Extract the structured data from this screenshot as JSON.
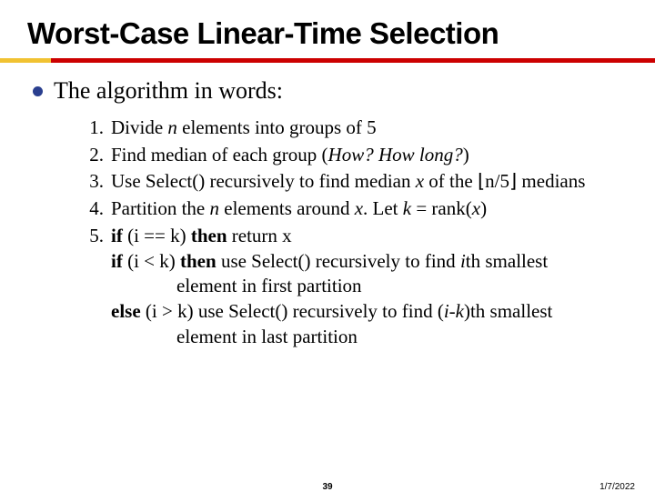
{
  "title": "Worst-Case Linear-Time Selection",
  "heading": "The algorithm in words:",
  "items": {
    "n1": "1.",
    "t1a": "Divide ",
    "t1b": "n",
    "t1c": " elements into groups of 5",
    "n2": "2.",
    "t2a": "Find median of each group (",
    "t2b": "How?  How long?",
    "t2c": ")",
    "n3": "3.",
    "t3a": "Use Select() recursively to find median ",
    "t3b": "x",
    "t3c": " of the ⌊n/5⌋ medians",
    "n4": "4.",
    "t4a": "Partition the ",
    "t4b": "n",
    "t4c": " elements around ",
    "t4d": "x",
    "t4e": ".  Let ",
    "t4f": "k",
    "t4g": " = rank(",
    "t4h": "x",
    "t4i": ")",
    "n5": "5.",
    "t5a": "if ",
    "t5b": "(i == k) ",
    "t5c": "then ",
    "t5d": "return x",
    "t5e": "if ",
    "t5f": "(i < k) ",
    "t5g": "then ",
    "t5h": "use Select() recursively to find ",
    "t5i": "i",
    "t5j": "th smallest",
    "t5k": "element in first partition",
    "t5l": "else ",
    "t5m": "(i > k) use Select() recursively to find (",
    "t5n": "i-k",
    "t5o": ")th smallest",
    "t5p": "element in last partition"
  },
  "footer": {
    "page": "39",
    "date": "1/7/2022"
  }
}
